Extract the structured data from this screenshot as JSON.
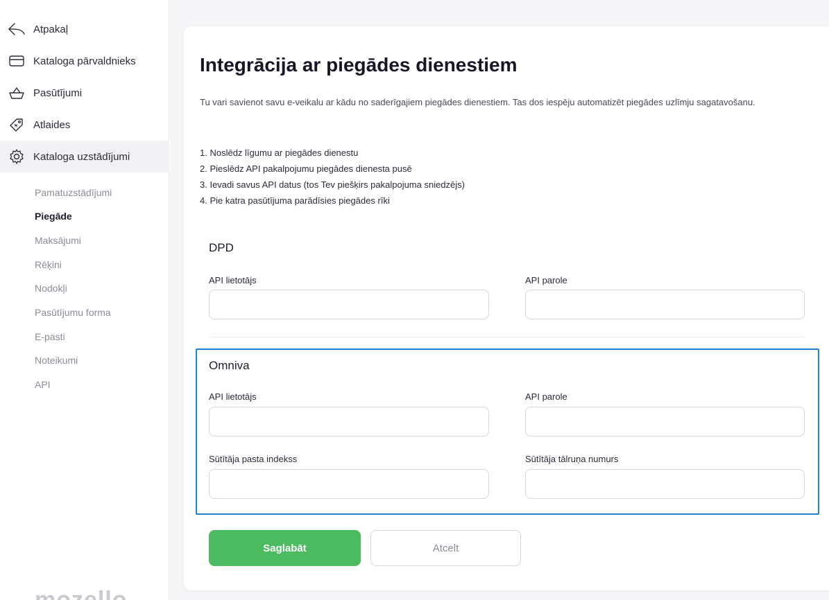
{
  "sidebar": {
    "nav": [
      {
        "label": "Atpakaļ",
        "icon": "back-arrow-icon"
      },
      {
        "label": "Kataloga pārvaldnieks",
        "icon": "folder-icon"
      },
      {
        "label": "Pasūtījumi",
        "icon": "basket-icon"
      },
      {
        "label": "Atlaides",
        "icon": "discount-tag-icon"
      },
      {
        "label": "Kataloga uzstādījumi",
        "icon": "gear-icon"
      }
    ],
    "sub": [
      {
        "label": "Pamatuzstādījumi"
      },
      {
        "label": "Piegāde"
      },
      {
        "label": "Maksājumi"
      },
      {
        "label": "Rēķini"
      },
      {
        "label": "Nodokļi"
      },
      {
        "label": "Pasūtījumu forma"
      },
      {
        "label": "E-pasti"
      },
      {
        "label": "Noteikumi"
      },
      {
        "label": "API"
      }
    ],
    "logo": "mozello"
  },
  "main": {
    "title": "Integrācija ar piegādes dienestiem",
    "description": "Tu vari savienot savu e-veikalu ar kādu no saderīgajiem piegādes dienestiem. Tas dos iespēju automatizēt piegādes uzlīmju sagatavošanu.",
    "steps": [
      "1. Noslēdz līgumu ar piegādes dienestu",
      "2. Pieslēdz API pakalpojumu piegādes dienesta pusē",
      "3. Ievadi savus API datus (tos Tev piešķirs pakalpojuma sniedzējs)",
      "4. Pie katra pasūtījuma parādīsies piegādes rīki"
    ],
    "dpd": {
      "title": "DPD",
      "user_label": "API lietotājs",
      "user_value": "",
      "password_label": "API parole",
      "password_value": ""
    },
    "omniva": {
      "title": "Omniva",
      "user_label": "API lietotājs",
      "user_value": "",
      "password_label": "API parole",
      "password_value": "",
      "postcode_label": "Sūtītāja pasta indekss",
      "postcode_value": "",
      "phone_label": "Sūtītāja tālruņa numurs",
      "phone_value": ""
    },
    "save_label": "Saglabāt",
    "cancel_label": "Atcelt"
  },
  "colors": {
    "accent_green": "#4cba5f",
    "highlight_blue": "#1e7fd6",
    "active_nav_bg": "#f2f2f4"
  }
}
